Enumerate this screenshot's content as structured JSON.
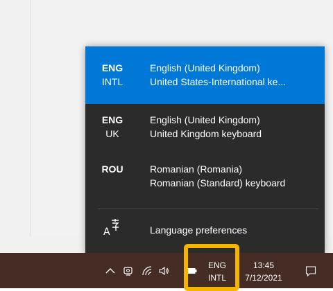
{
  "flyout": {
    "items": [
      {
        "code_line1": "ENG",
        "code_line2": "INTL",
        "name": "English (United Kingdom)",
        "keyboard": "United States-International ke...",
        "selected": true
      },
      {
        "code_line1": "ENG",
        "code_line2": "UK",
        "name": "English (United Kingdom)",
        "keyboard": "United Kingdom keyboard",
        "selected": false
      },
      {
        "code_line1": "ROU",
        "code_line2": "",
        "name": "Romanian (Romania)",
        "keyboard": "Romanian (Standard) keyboard",
        "selected": false
      }
    ],
    "preferences_label": "Language preferences",
    "preferences_icon": "language-preferences-icon"
  },
  "taskbar": {
    "input_indicator": {
      "line1": "ENG",
      "line2": "INTL"
    },
    "clock": {
      "time": "13:45",
      "date": "7/12/2021"
    },
    "tray_icons": [
      "chevron-up-icon",
      "meet-now-icon",
      "wifi-icon",
      "speaker-icon",
      "battery-icon"
    ],
    "notification_icon": "action-center-icon"
  },
  "colors": {
    "selected": "#0078d7",
    "flyout_bg": "#2b2b2b",
    "taskbar_bg": "#452d25",
    "highlight": "#f5b400"
  }
}
